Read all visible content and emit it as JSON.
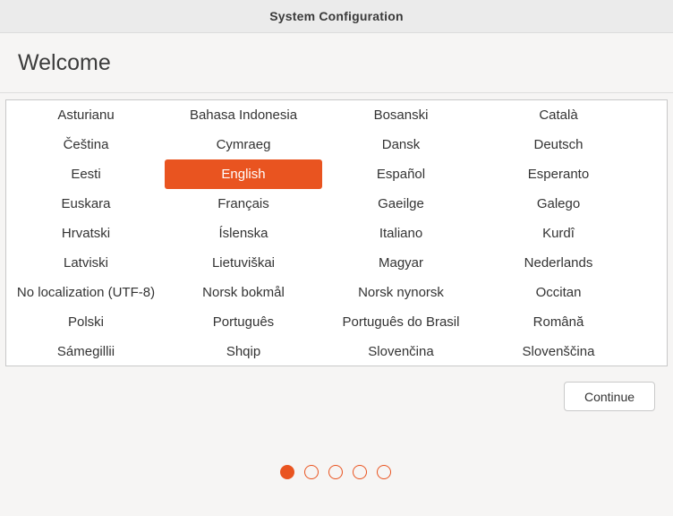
{
  "window": {
    "title": "System Configuration"
  },
  "header": {
    "heading": "Welcome"
  },
  "languages": {
    "selected": "English",
    "items": [
      "Asturianu",
      "Bahasa Indonesia",
      "Bosanski",
      "Català",
      "Čeština",
      "Cymraeg",
      "Dansk",
      "Deutsch",
      "Eesti",
      "English",
      "Español",
      "Esperanto",
      "Euskara",
      "Français",
      "Gaeilge",
      "Galego",
      "Hrvatski",
      "Íslenska",
      "Italiano",
      "Kurdî",
      "Latviski",
      "Lietuviškai",
      "Magyar",
      "Nederlands",
      "No localization (UTF-8)",
      "Norsk bokmål",
      "Norsk nynorsk",
      "Occitan",
      "Polski",
      "Português",
      "Português do Brasil",
      "Română",
      "Sámegillii",
      "Shqip",
      "Slovenčina",
      "Slovenščina"
    ]
  },
  "actions": {
    "continue_label": "Continue"
  },
  "pager": {
    "total": 5,
    "current": 1
  },
  "colors": {
    "accent": "#e95420"
  }
}
